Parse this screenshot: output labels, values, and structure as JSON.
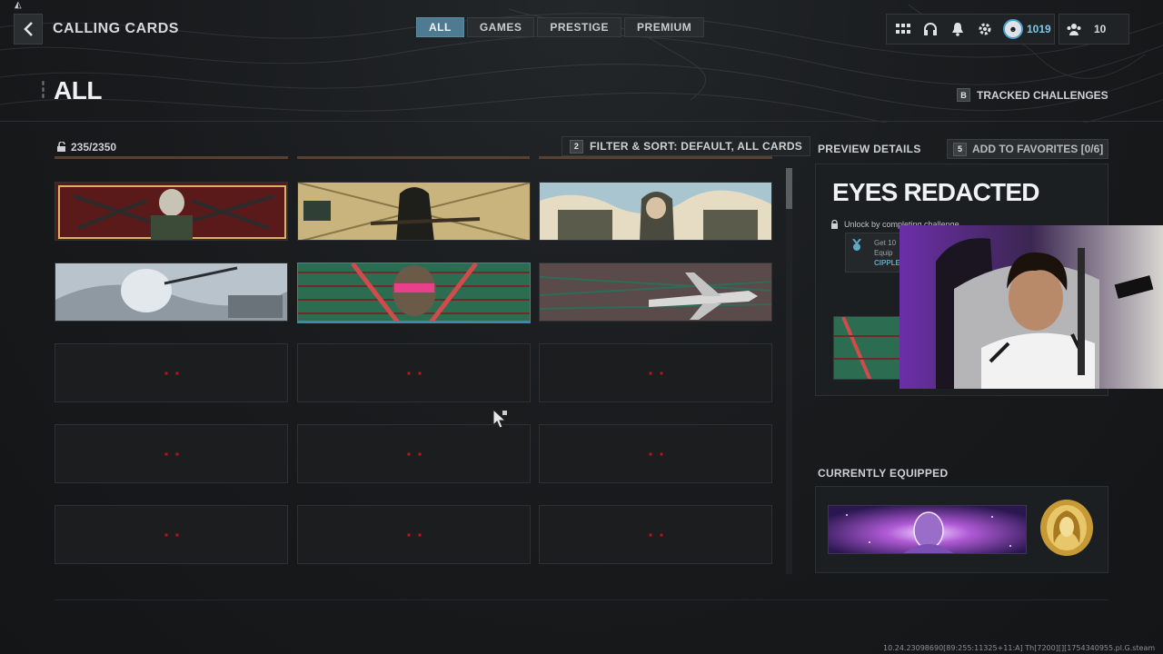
{
  "header": {
    "title": "CALLING CARDS",
    "back_icon": "chevron-left-icon",
    "tabs": [
      {
        "label": "ALL",
        "active": true
      },
      {
        "label": "GAMES",
        "active": false
      },
      {
        "label": "PRESTIGE",
        "active": false
      },
      {
        "label": "PREMIUM",
        "active": false
      }
    ],
    "hud": {
      "icons": [
        "grid-menu-icon",
        "headset-icon",
        "bell-icon",
        "gear-icon"
      ],
      "level": "1019",
      "party_count": "10"
    }
  },
  "page": {
    "heading": "ALL",
    "tracked_key": "B",
    "tracked_label": "TRACKED CHALLENGES"
  },
  "grid": {
    "unlock_count": "235/2350",
    "filter_key": "2",
    "filter_label": "FILTER & SORT: DEFAULT, ALL CARDS",
    "accent_color": "#4f7b92",
    "lock_color": "#c0101a"
  },
  "preview": {
    "label": "PREVIEW DETAILS",
    "favorites_key": "5",
    "favorites_label": "ADD TO FAVORITES [0/6]",
    "card_name": "EYES REDACTED",
    "unlock_text": "Unlock by completing challenge",
    "challenge_text": "Get 10\nEquip",
    "challenge_tag": "CIPPLE"
  },
  "equipped": {
    "label": "CURRENTLY EQUIPPED"
  },
  "footer": {
    "build": "10.24.23098690[89:255:11325+11:A] Th[7200][][1754340955.pl.G.steam"
  }
}
